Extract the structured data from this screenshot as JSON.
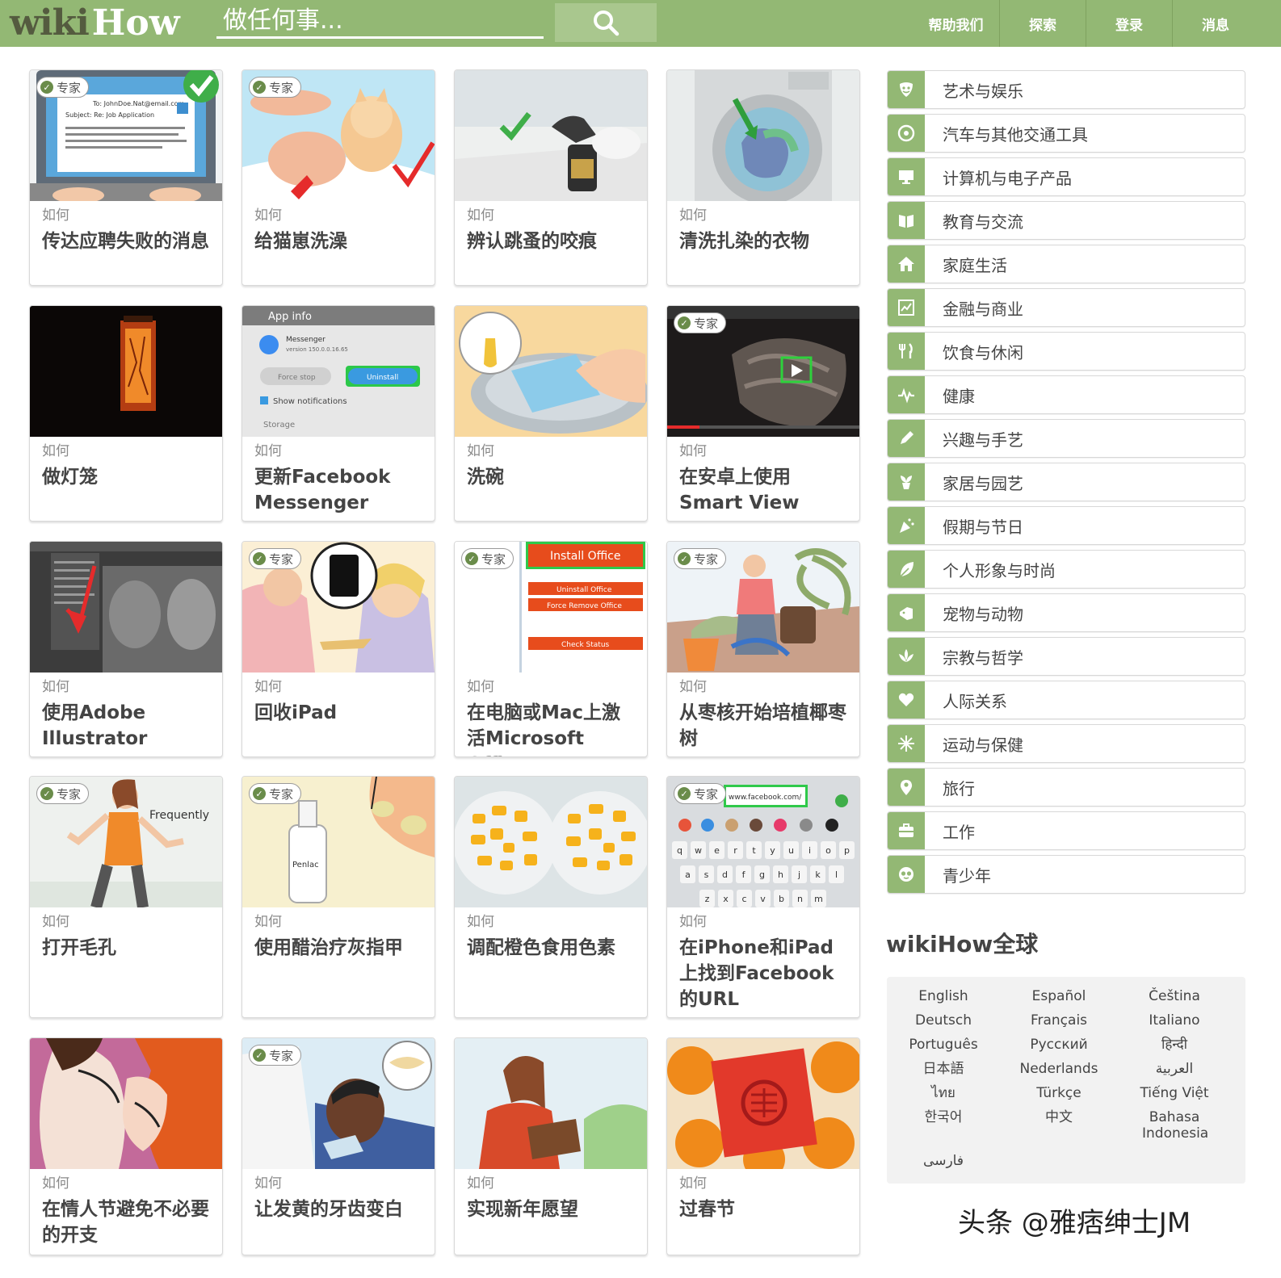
{
  "header": {
    "logo_wiki": "wiki",
    "logo_how": "How",
    "search_placeholder": "做任何事...",
    "nav": [
      "帮助我们",
      "探索",
      "登录",
      "消息"
    ]
  },
  "articles": [
    {
      "prefix": "如何",
      "title": "传达应聘失败的消息",
      "expert": true
    },
    {
      "prefix": "如何",
      "title": "给猫崽洗澡",
      "expert": true
    },
    {
      "prefix": "如何",
      "title": "辨认跳蚤的咬痕",
      "expert": false
    },
    {
      "prefix": "如何",
      "title": "清洗扎染的衣物",
      "expert": false
    },
    {
      "prefix": "如何",
      "title": "做灯笼",
      "expert": false
    },
    {
      "prefix": "如何",
      "title": "更新Facebook Messenger",
      "expert": false
    },
    {
      "prefix": "如何",
      "title": "洗碗",
      "expert": false
    },
    {
      "prefix": "如何",
      "title": "在安卓上使用Smart View",
      "expert": true
    },
    {
      "prefix": "如何",
      "title": "使用Adobe Illustrator",
      "expert": false
    },
    {
      "prefix": "如何",
      "title": "回收iPad",
      "expert": true
    },
    {
      "prefix": "如何",
      "title": "在电脑或Mac上激活Microsoft Office",
      "expert": true
    },
    {
      "prefix": "如何",
      "title": "从枣核开始培植椰枣树",
      "expert": true
    },
    {
      "prefix": "如何",
      "title": "打开毛孔",
      "expert": true
    },
    {
      "prefix": "如何",
      "title": "使用醋治疗灰指甲",
      "expert": true
    },
    {
      "prefix": "如何",
      "title": "调配橙色食用色素",
      "expert": false
    },
    {
      "prefix": "如何",
      "title": "在iPhone和iPad上找到Facebook的URL",
      "expert": true
    },
    {
      "prefix": "如何",
      "title": "在情人节避免不必要的开支",
      "expert": false
    },
    {
      "prefix": "如何",
      "title": "让发黄的牙齿变白",
      "expert": true
    },
    {
      "prefix": "如何",
      "title": "实现新年愿望",
      "expert": false
    },
    {
      "prefix": "如何",
      "title": "过春节",
      "expert": false
    }
  ],
  "expert_label": "专家",
  "thumb_text": {
    "email_to": "To: JohnDoe.Nat@email.com",
    "email_subject": "Subject: Re: Job Application",
    "app_info": "App info",
    "messenger": "Messenger",
    "messenger_version": "version 150.0.0.16.65",
    "force_stop": "Force stop",
    "uninstall": "Uninstall",
    "show_notifications": "Show notifications",
    "storage": "Storage",
    "install_office": "Install Office",
    "uninstall_office": "Uninstall Office",
    "force_remove_office": "Force Remove Office",
    "check_status": "Check Status",
    "frequently": "Frequently",
    "penlac": "Penlac",
    "facebook_url": "www.facebook.com/",
    "keyboard_row1": [
      "q",
      "w",
      "e",
      "r",
      "t",
      "y",
      "u",
      "i",
      "o",
      "p"
    ],
    "keyboard_row2": [
      "a",
      "s",
      "d",
      "f",
      "g",
      "h",
      "j",
      "k",
      "l"
    ],
    "keyboard_row3": [
      "z",
      "x",
      "c",
      "v",
      "b",
      "n",
      "m"
    ]
  },
  "categories": [
    {
      "label": "艺术与娱乐",
      "icon": "theater-masks-icon"
    },
    {
      "label": "汽车与其他交通工具",
      "icon": "wheel-icon"
    },
    {
      "label": "计算机与电子产品",
      "icon": "monitor-icon"
    },
    {
      "label": "教育与交流",
      "icon": "book-icon"
    },
    {
      "label": "家庭生活",
      "icon": "house-icon"
    },
    {
      "label": "金融与商业",
      "icon": "chart-icon"
    },
    {
      "label": "饮食与休闲",
      "icon": "utensils-icon"
    },
    {
      "label": "健康",
      "icon": "heartbeat-icon"
    },
    {
      "label": "兴趣与手艺",
      "icon": "pencil-icon"
    },
    {
      "label": "家居与园艺",
      "icon": "plant-icon"
    },
    {
      "label": "假期与节日",
      "icon": "party-icon"
    },
    {
      "label": "个人形象与时尚",
      "icon": "leaf-icon"
    },
    {
      "label": "宠物与动物",
      "icon": "pet-icon"
    },
    {
      "label": "宗教与哲学",
      "icon": "lotus-icon"
    },
    {
      "label": "人际关系",
      "icon": "heart-icon"
    },
    {
      "label": "运动与保健",
      "icon": "sport-icon"
    },
    {
      "label": "旅行",
      "icon": "map-pin-icon"
    },
    {
      "label": "工作",
      "icon": "briefcase-icon"
    },
    {
      "label": "青少年",
      "icon": "face-icon"
    }
  ],
  "global": {
    "title": "wikiHow全球",
    "languages": [
      "English",
      "Español",
      "Čeština",
      "Deutsch",
      "Français",
      "Italiano",
      "Português",
      "Русский",
      "हिन्दी",
      "日本語",
      "Nederlands",
      "العربية",
      "ไทย",
      "Türkçe",
      "Tiếng Việt",
      "한국어",
      "中文",
      "Bahasa Indonesia",
      "فارسی"
    ]
  },
  "watermark": "头条 @雅痞绅士JM",
  "colors": {
    "brand_green": "#93b874",
    "logo_dark": "#545b3f",
    "text": "#444444"
  }
}
